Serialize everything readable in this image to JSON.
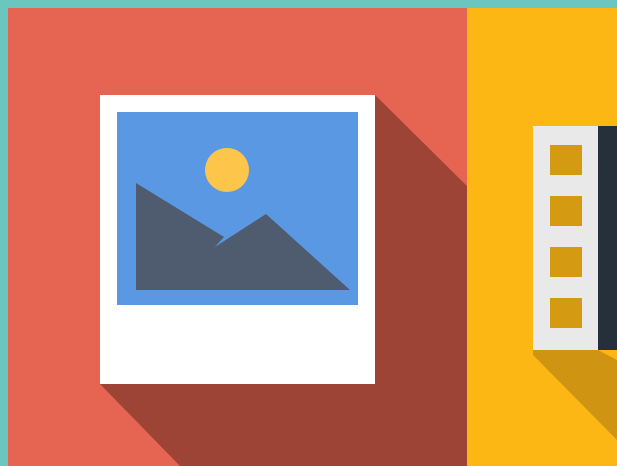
{
  "colors": {
    "frame": "#6cc6c0",
    "image_tile": "#e56452",
    "image_tile_shadow": "#9e4436",
    "video_tile": "#fcb714",
    "video_tile_shadow": "#cf9512",
    "photo_card": "#ffffff",
    "photo_sky": "#5a98e4",
    "photo_sun": "#fdc64a",
    "photo_mountain": "#4f5b6e",
    "film_strip": "#e9e9e9",
    "film_hole": "#d49a12",
    "film_dark": "#25303a"
  },
  "tiles": [
    {
      "name": "image",
      "icon": "photo-icon"
    },
    {
      "name": "video",
      "icon": "film-strip-icon"
    }
  ]
}
